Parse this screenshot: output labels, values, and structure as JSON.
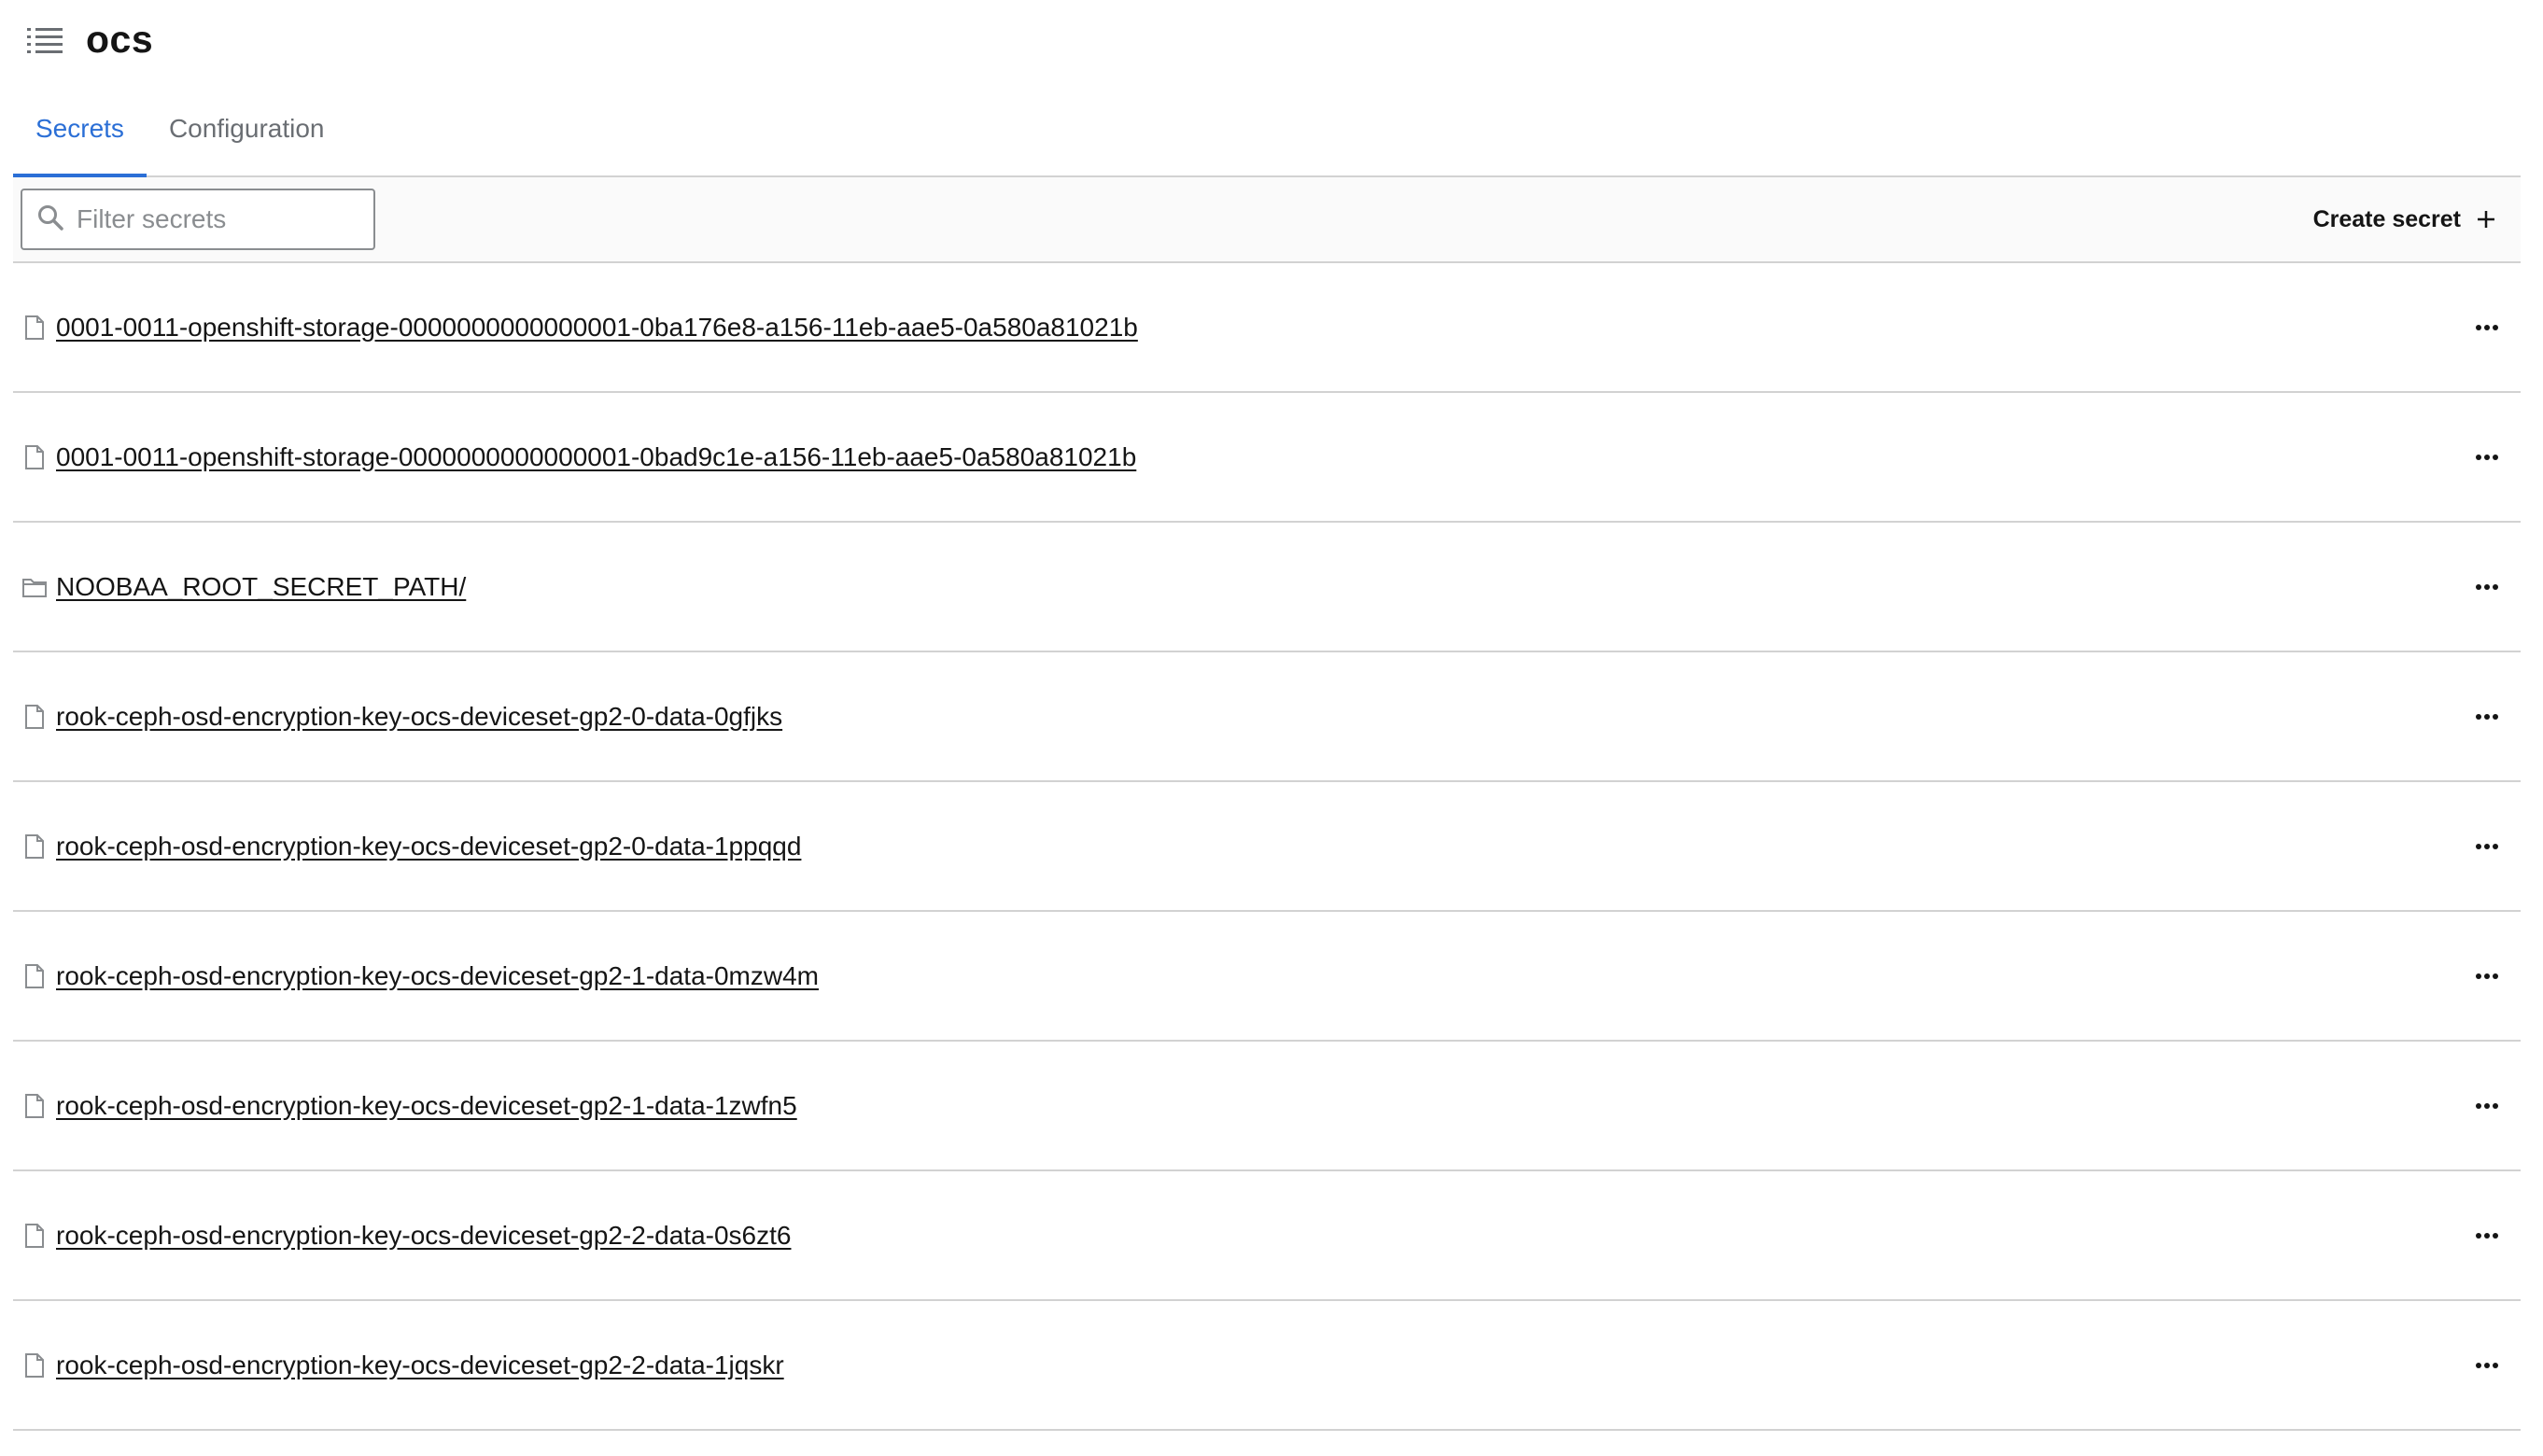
{
  "header": {
    "title": "ocs",
    "menu_icon": "list-icon"
  },
  "tabs": [
    {
      "label": "Secrets",
      "active": true
    },
    {
      "label": "Configuration",
      "active": false
    }
  ],
  "toolbar": {
    "search_placeholder": "Filter secrets",
    "search_value": "",
    "create_label": "Create secret"
  },
  "colors": {
    "accent": "#2b6fd6",
    "border": "#d2d2d2",
    "text": "#151515",
    "muted": "#6a6e73"
  },
  "secrets": [
    {
      "name": "0001-0011-openshift-storage-0000000000000001-0ba176e8-a156-11eb-aae5-0a580a81021b",
      "type": "file",
      "icon": "file-icon"
    },
    {
      "name": "0001-0011-openshift-storage-0000000000000001-0bad9c1e-a156-11eb-aae5-0a580a81021b",
      "type": "file",
      "icon": "file-icon"
    },
    {
      "name": "NOOBAA_ROOT_SECRET_PATH/",
      "type": "folder",
      "icon": "folder-icon"
    },
    {
      "name": "rook-ceph-osd-encryption-key-ocs-deviceset-gp2-0-data-0gfjks",
      "type": "file",
      "icon": "file-icon"
    },
    {
      "name": "rook-ceph-osd-encryption-key-ocs-deviceset-gp2-0-data-1ppqqd",
      "type": "file",
      "icon": "file-icon"
    },
    {
      "name": "rook-ceph-osd-encryption-key-ocs-deviceset-gp2-1-data-0mzw4m",
      "type": "file",
      "icon": "file-icon"
    },
    {
      "name": "rook-ceph-osd-encryption-key-ocs-deviceset-gp2-1-data-1zwfn5",
      "type": "file",
      "icon": "file-icon"
    },
    {
      "name": "rook-ceph-osd-encryption-key-ocs-deviceset-gp2-2-data-0s6zt6",
      "type": "file",
      "icon": "file-icon"
    },
    {
      "name": "rook-ceph-osd-encryption-key-ocs-deviceset-gp2-2-data-1jqskr",
      "type": "file",
      "icon": "file-icon"
    }
  ]
}
